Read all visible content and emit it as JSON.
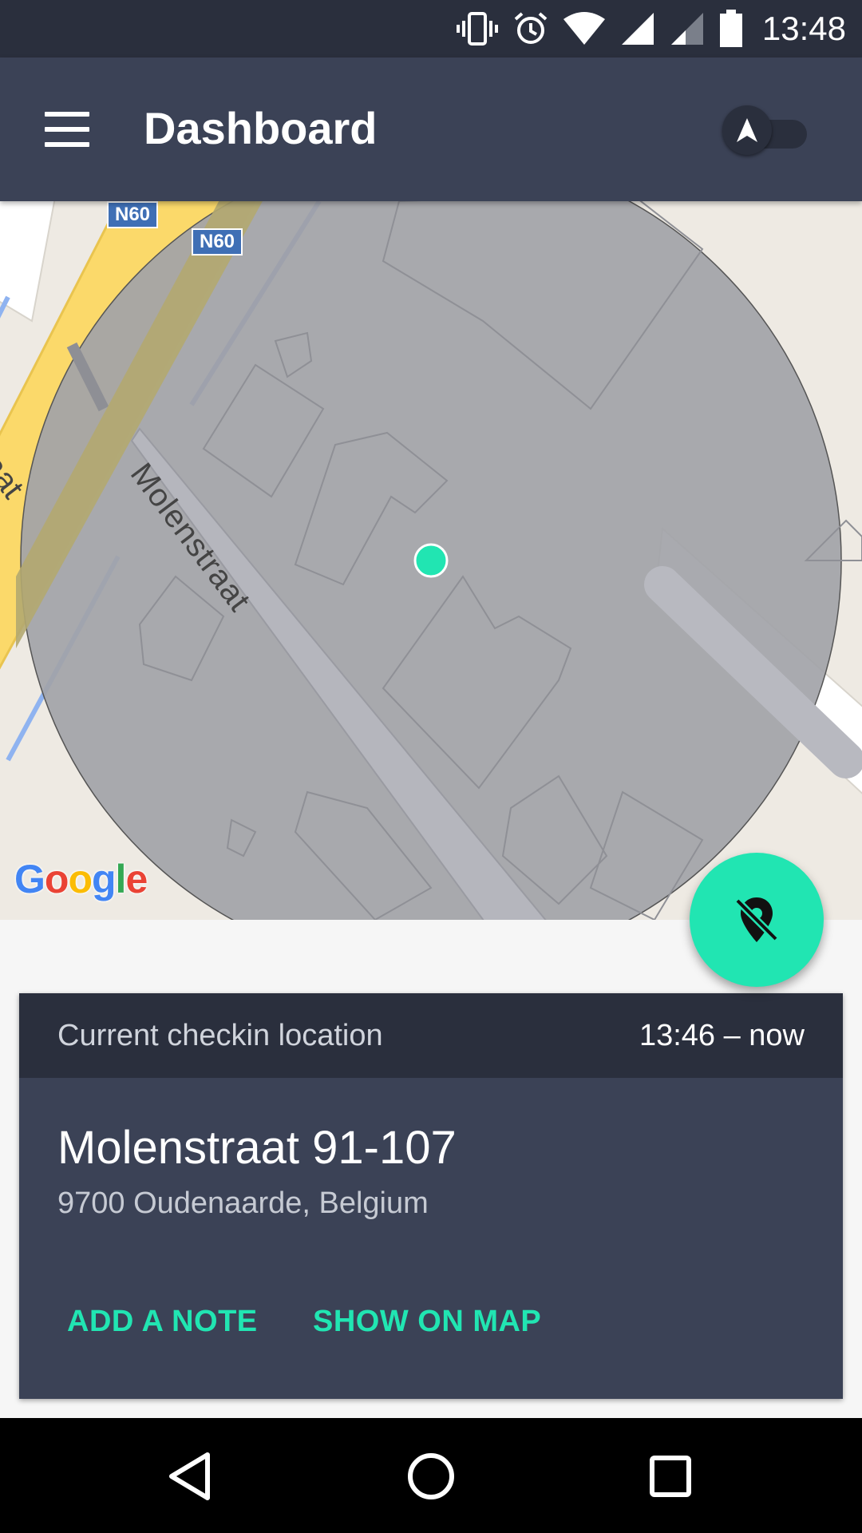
{
  "status_bar": {
    "time": "13:48",
    "icons": [
      "vibrate-icon",
      "alarm-icon",
      "wifi-icon",
      "signal-icon",
      "signal-weak-icon",
      "battery-icon"
    ]
  },
  "app_bar": {
    "title": "Dashboard",
    "menu_icon": "hamburger-menu-icon",
    "toggle_icon": "navigation-arrow-icon"
  },
  "map": {
    "street_label": "Molenstraat",
    "partial_label": "traat",
    "road_badges": [
      "N60",
      "N60"
    ],
    "attribution": "Google",
    "colors": {
      "accuracy_circle": "#a9aaae",
      "location_dot": "#21e5b2",
      "main_road": "#fbd96a",
      "land": "#eeeae3"
    }
  },
  "fab": {
    "icon": "location-off-icon"
  },
  "checkin_card": {
    "header_label": "Current checkin location",
    "time_range": "13:46 – now",
    "address_line1": "Molenstraat 91-107",
    "address_line2": "9700 Oudenaarde, Belgium",
    "actions": {
      "add_note": "ADD A NOTE",
      "show_on_map": "SHOW ON MAP"
    }
  },
  "nav_bar": {
    "buttons": [
      "back-icon",
      "home-icon",
      "recents-icon"
    ]
  },
  "theme": {
    "accent": "#21e5b2",
    "primary": "#3b4256",
    "primary_dark": "#2a2f3d"
  }
}
